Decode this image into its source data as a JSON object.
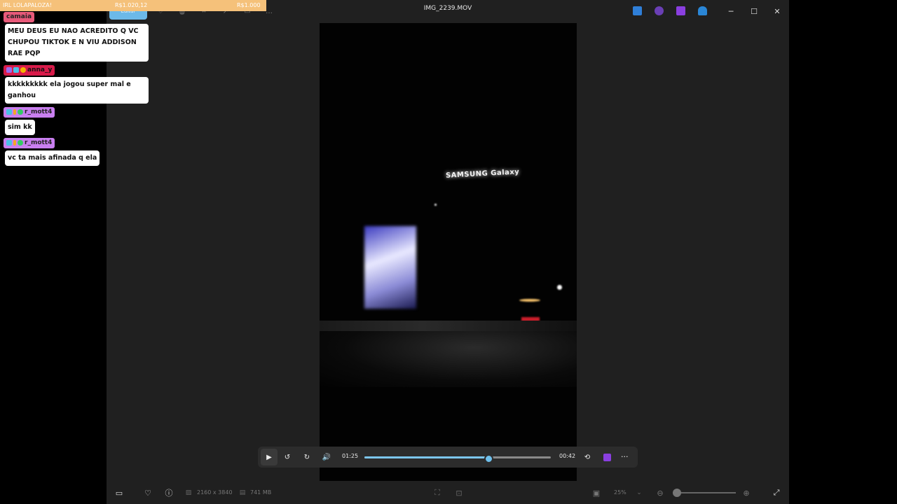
{
  "window": {
    "title": "IMG_2239.MOV",
    "edit_label": "Editar",
    "minimize": "─",
    "maximize": "☐",
    "close": "✕"
  },
  "video_overlay": {
    "sign_text": "SAMSUNG Galaxy"
  },
  "player": {
    "elapsed": "01:25",
    "remaining": "00:42",
    "progress_fraction": 0.66,
    "play_icon": "play-icon",
    "more": "···"
  },
  "status": {
    "dimensions": "2160 x 3840",
    "filesize": "741 MB",
    "zoom": "25%"
  },
  "stream": {
    "banner_left": "IRL LOLAPALOZA!",
    "banner_mid": "R$1.020,12",
    "banner_right": "R$1.000",
    "chat": [
      {
        "user": "camaia",
        "color": "#e85a7a",
        "text_lines": [
          "MEU DEUS EU NAO ACREDITO Q VC",
          "CHUPOU TIKTOK E N VIU ADDISON",
          "RAE PQP"
        ]
      },
      {
        "user": "anna_y",
        "color": "#d81b4a",
        "text_lines": [
          "kkkkkkkkk ela jogou super mal e",
          "ganhou"
        ]
      },
      {
        "user": "r_mott4",
        "color": "#c97ff0",
        "text_lines": [
          "sim kk"
        ]
      },
      {
        "user": "r_mott4",
        "color": "#c97ff0",
        "text_lines": [
          "vc ta mais afinada q ela"
        ]
      }
    ]
  },
  "colors": {
    "accent": "#6fc0ec",
    "app_bg": "#202020"
  }
}
